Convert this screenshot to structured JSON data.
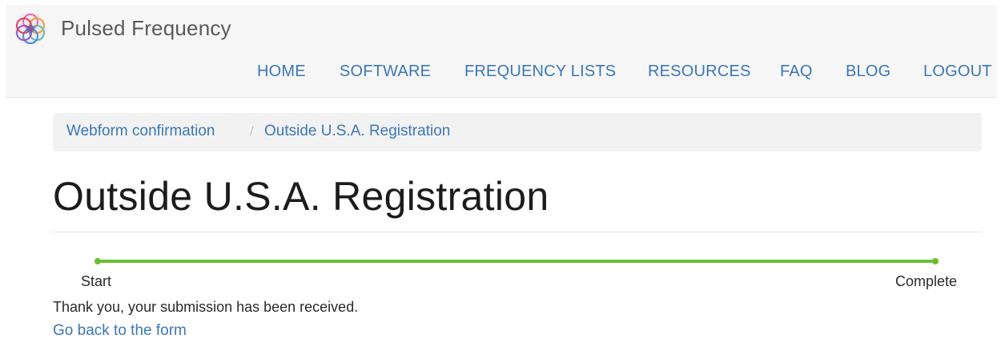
{
  "brand": {
    "logo_icon": "flower-of-life-logo",
    "name": "Pulsed Frequency"
  },
  "nav": {
    "items": [
      {
        "label": "HOME"
      },
      {
        "label": "SOFTWARE"
      },
      {
        "label": "FREQUENCY LISTS"
      },
      {
        "label": "RESOURCES"
      },
      {
        "label": "FAQ"
      },
      {
        "label": "BLOG"
      },
      {
        "label": "LOGOUT"
      }
    ]
  },
  "breadcrumb": {
    "items": [
      {
        "label": "Webform confirmation"
      },
      {
        "label": "Outside U.S.A. Registration"
      }
    ],
    "separator": "/"
  },
  "page": {
    "title": "Outside U.S.A. Registration"
  },
  "progress": {
    "start_label": "Start",
    "end_label": "Complete",
    "fraction_complete": 1.0,
    "color": "#6cbf33"
  },
  "confirmation": {
    "message": "Thank you, your submission has been received.",
    "back_link": "Go back to the form"
  },
  "colors": {
    "link": "#3c78b4",
    "navbar_bg": "#f6f6f6",
    "breadcrumb_bg": "#f2f2f2"
  }
}
